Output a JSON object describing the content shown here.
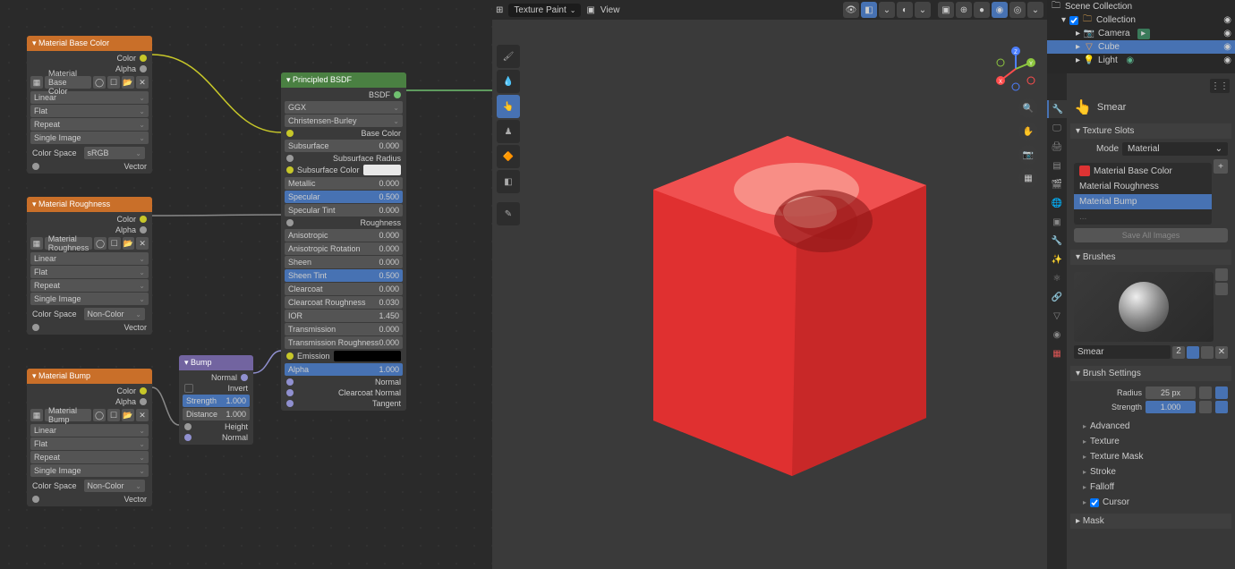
{
  "nodes": {
    "base_color": {
      "title": "Material Base Color",
      "out_color": "Color",
      "out_alpha": "Alpha",
      "img_name": "Material Base Color",
      "interp": "Linear",
      "proj": "Flat",
      "ext": "Repeat",
      "src": "Single Image",
      "cs_label": "Color Space",
      "cs_value": "sRGB",
      "vector": "Vector"
    },
    "roughness": {
      "title": "Material Roughness",
      "out_color": "Color",
      "out_alpha": "Alpha",
      "img_name": "Material Roughness",
      "interp": "Linear",
      "proj": "Flat",
      "ext": "Repeat",
      "src": "Single Image",
      "cs_label": "Color Space",
      "cs_value": "Non-Color",
      "vector": "Vector"
    },
    "bump_tex": {
      "title": "Material Bump",
      "out_color": "Color",
      "out_alpha": "Alpha",
      "img_name": "Material Bump",
      "interp": "Linear",
      "proj": "Flat",
      "ext": "Repeat",
      "src": "Single Image",
      "cs_label": "Color Space",
      "cs_value": "Non-Color",
      "vector": "Vector"
    },
    "bump": {
      "title": "Bump",
      "out_normal": "Normal",
      "invert": "Invert",
      "strength_l": "Strength",
      "strength_v": "1.000",
      "distance_l": "Distance",
      "distance_v": "1.000",
      "height": "Height",
      "normal": "Normal"
    },
    "principled": {
      "title": "Principled BSDF",
      "out_bsdf": "BSDF",
      "dist": "GGX",
      "sss": "Christensen-Burley",
      "base_color": "Base Color",
      "subsurface_l": "Subsurface",
      "subsurface_v": "0.000",
      "ss_radius": "Subsurface Radius",
      "ss_color": "Subsurface Color",
      "metallic_l": "Metallic",
      "metallic_v": "0.000",
      "specular_l": "Specular",
      "specular_v": "0.500",
      "spectint_l": "Specular Tint",
      "spectint_v": "0.000",
      "roughness": "Roughness",
      "aniso_l": "Anisotropic",
      "aniso_v": "0.000",
      "anisorot_l": "Anisotropic Rotation",
      "anisorot_v": "0.000",
      "sheen_l": "Sheen",
      "sheen_v": "0.000",
      "sheentint_l": "Sheen Tint",
      "sheentint_v": "0.500",
      "clearcoat_l": "Clearcoat",
      "clearcoat_v": "0.000",
      "ccrr_l": "Clearcoat Roughness",
      "ccrr_v": "0.030",
      "ior_l": "IOR",
      "ior_v": "1.450",
      "trans_l": "Transmission",
      "trans_v": "0.000",
      "transr_l": "Transmission Roughness",
      "transr_v": "0.000",
      "emission": "Emission",
      "alpha_l": "Alpha",
      "alpha_v": "1.000",
      "normal": "Normal",
      "cc_normal": "Clearcoat Normal",
      "tangent": "Tangent"
    }
  },
  "viewport": {
    "mode": "Texture Paint",
    "view": "View"
  },
  "outliner": {
    "scene": "Scene Collection",
    "collection": "Collection",
    "camera": "Camera",
    "cube": "Cube",
    "light": "Light"
  },
  "props": {
    "tool_name": "Smear",
    "texture_slots_title": "Texture Slots",
    "mode_label": "Mode",
    "mode_value": "Material",
    "slot1": "Material Base Color",
    "slot2": "Material Roughness",
    "slot3": "Material Bump",
    "save_all": "Save All Images",
    "brushes_title": "Brushes",
    "brush_name": "Smear",
    "brush_users": "2",
    "brush_settings_title": "Brush Settings",
    "radius_l": "Radius",
    "radius_v": "25 px",
    "strength_l": "Strength",
    "strength_v": "1.000",
    "advanced": "Advanced",
    "texture": "Texture",
    "texture_mask": "Texture Mask",
    "stroke": "Stroke",
    "falloff": "Falloff",
    "cursor": "Cursor",
    "mask": "Mask"
  }
}
